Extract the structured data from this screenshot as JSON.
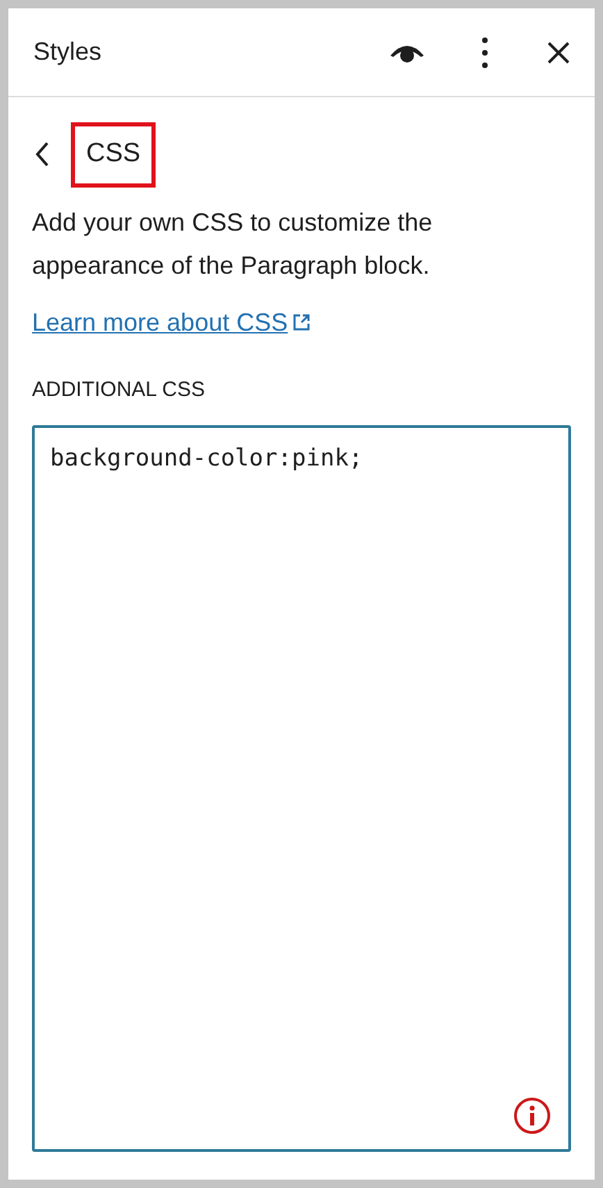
{
  "header": {
    "title": "Styles"
  },
  "section": {
    "title": "CSS",
    "highlighted": true
  },
  "description": "Add your own CSS to customize the appearance of the Paragraph block.",
  "link": "Learn more about CSS",
  "field": {
    "label": "ADDITIONAL CSS",
    "value": "background-color:pink;",
    "invalid": true
  }
}
